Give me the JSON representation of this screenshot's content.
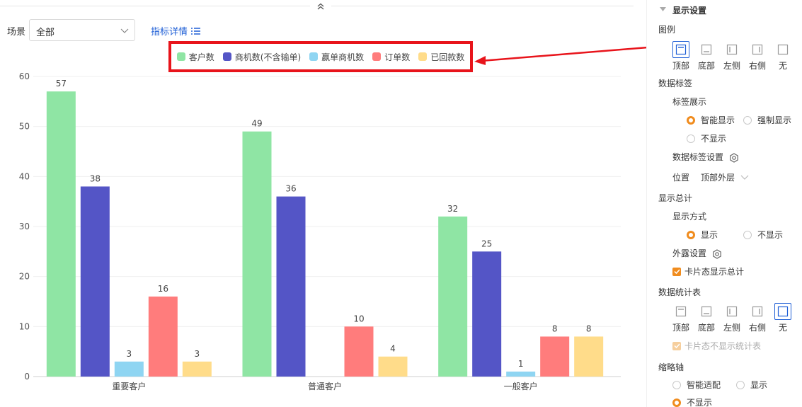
{
  "toolbar": {
    "scene_label": "场景",
    "scene_value": "全部",
    "metric_link": "指标详情"
  },
  "colors": {
    "customers": "#8fe5a4",
    "opportunities": "#5455c6",
    "won": "#8fd5f2",
    "orders": "#ff7c7c",
    "payments": "#ffdc8a",
    "accent": "#f08c1e",
    "link": "#1f5fd6",
    "highlight": "#e8141b"
  },
  "chart_data": {
    "type": "bar",
    "categories": [
      "重要客户",
      "普通客户",
      "一般客户"
    ],
    "series": [
      {
        "name": "客户数",
        "color": "#8fe5a4",
        "values": [
          57,
          49,
          32
        ]
      },
      {
        "name": "商机数(不含输单)",
        "color": "#5455c6",
        "values": [
          38,
          36,
          25
        ]
      },
      {
        "name": "赢单商机数",
        "color": "#8fd5f2",
        "values": [
          3,
          0,
          1
        ]
      },
      {
        "name": "订单数",
        "color": "#ff7c7c",
        "values": [
          16,
          10,
          8
        ]
      },
      {
        "name": "已回款数",
        "color": "#ffdc8a",
        "values": [
          3,
          4,
          8
        ]
      }
    ],
    "data_labels": [
      [
        "57",
        "38",
        "3",
        "16",
        "3"
      ],
      [
        "49",
        "36",
        "",
        "10",
        "4"
      ],
      [
        "32",
        "25",
        "1",
        "8",
        "8"
      ]
    ],
    "yticks": [
      "0",
      "10",
      "20",
      "30",
      "40",
      "50",
      "60"
    ],
    "ylim": [
      0,
      60
    ],
    "grid": true,
    "legend_position": "top-center"
  },
  "panel": {
    "title": "显示设置",
    "legend": {
      "label": "图例",
      "options": [
        "顶部",
        "底部",
        "左侧",
        "右侧",
        "无"
      ],
      "selected": "顶部"
    },
    "data_labels": {
      "label": "数据标签",
      "display_label": "标签展示",
      "display_options": [
        "智能显示",
        "强制显示",
        "不显示"
      ],
      "display_selected": "智能显示",
      "settings_label": "数据标签设置",
      "position_label": "位置",
      "position_value": "顶部外层"
    },
    "total": {
      "label": "显示总计",
      "mode_label": "显示方式",
      "mode_options": [
        "显示",
        "不显示"
      ],
      "mode_selected": "显示",
      "exposure_label": "外露设置",
      "card_total_label": "卡片态显示总计"
    },
    "stats_table": {
      "label": "数据统计表",
      "options": [
        "顶部",
        "底部",
        "左侧",
        "右侧",
        "无"
      ],
      "selected": "无",
      "card_hide_label": "卡片态不显示统计表"
    },
    "zoom_axis": {
      "label": "缩略轴",
      "options": [
        "智能适配",
        "显示",
        "不显示"
      ],
      "selected": "不显示"
    }
  }
}
